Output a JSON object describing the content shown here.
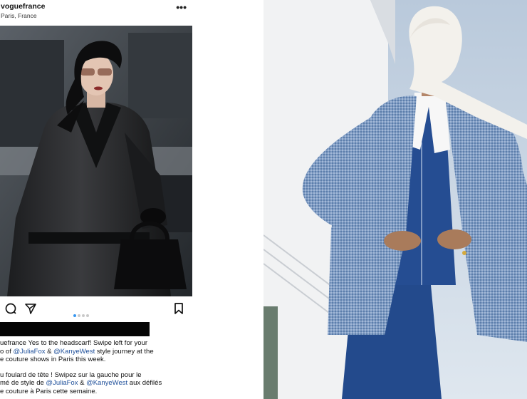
{
  "post": {
    "username": "voguefrance",
    "location": "Paris, France",
    "more_label": "•••",
    "carousel": {
      "count": 4,
      "active_index": 0
    },
    "caption": {
      "en_lines": [
        "uefrance Yes to the headscarf! Swipe left for your",
        "o of ",
        "e couture shows in Paris this week."
      ],
      "en_mention_1": "@JuliaFox",
      "en_amp": " & ",
      "en_mention_2": "@KanyeWest",
      "en_tail_2": " style journey at the",
      "fr_line_1": "u foulard de tête ! Swipez sur la gauche pour le",
      "fr_line_2_head": "mé de style de ",
      "fr_mention_1": "@JuliaFox",
      "fr_amp": " & ",
      "fr_mention_2": "@KanyeWest",
      "fr_line_2_tail": " aux défilés",
      "fr_line_3": "e couture à Paris cette semaine."
    }
  },
  "icons": {
    "comment": "comment-icon",
    "share": "share-icon",
    "save": "bookmark-icon",
    "more": "more-icon"
  },
  "colors": {
    "carousel_active": "#3897f0",
    "carousel_inactive": "#c9c9c9",
    "mention": "#1e4f9a",
    "jacket_blue": "#6f8fb8",
    "sky": "#c7d4e3"
  }
}
